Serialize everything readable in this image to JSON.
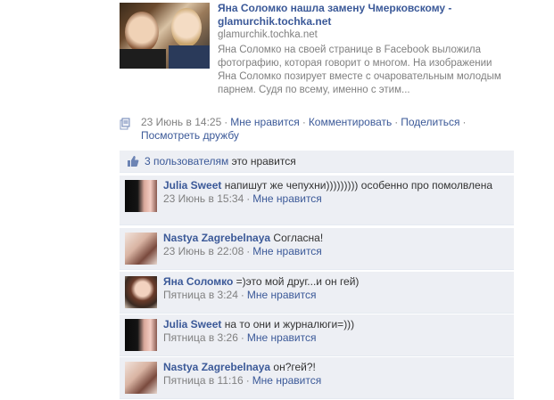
{
  "story": {
    "title": "Яна Соломко нашла замену Чмерковскому - glamurchik.tochka.net",
    "domain": "glamurchik.tochka.net",
    "description": "Яна Соломко на своей странице в Facebook выложила фотографию, которая говорит о многом. На изображении Яна Соломко позирует вместе с очаровательным молодым парнем. Судя по всему, именно с этим..."
  },
  "actions": {
    "timestamp": "23 Июнь в 14:25",
    "like_label": "Мне нравится",
    "comment_label": "Комментировать",
    "share_label": "Поделиться",
    "see_friendship_label": "Посмотреть дружбу",
    "separator": "·"
  },
  "likes": {
    "count_link": "3 пользователям",
    "suffix": " это нравится"
  },
  "comments": [
    {
      "name": "Julia Sweet",
      "text": "напишут же чепухни))))))))) особенно про помолвлена",
      "time": "23 Июнь в 15:34",
      "like_label": "Мне нравится"
    },
    {
      "name": "Nastya Zagrebelnaya",
      "text": "Согласна!",
      "time": "23 Июнь в 22:08",
      "like_label": "Мне нравится"
    },
    {
      "name": "Яна Соломко",
      "text": "=)это мой друг...и он гей)",
      "time": "Пятница в 3:24",
      "like_label": "Мне нравится"
    },
    {
      "name": "Julia Sweet",
      "text": "на то они и журналюги=)))",
      "time": "Пятница в 3:26",
      "like_label": "Мне нравится"
    },
    {
      "name": "Nastya Zagrebelnaya",
      "text": "он?гей?!",
      "time": "Пятница в 11:16",
      "like_label": "Мне нравится"
    }
  ]
}
